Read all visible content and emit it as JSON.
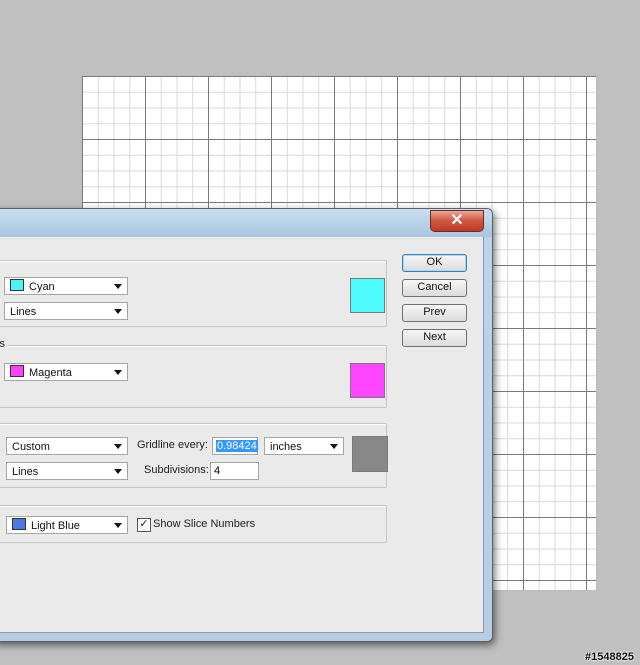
{
  "dialog": {
    "close_glyph": "✕"
  },
  "buttons": {
    "ok": "OK",
    "cancel": "Cancel",
    "prev": "Prev",
    "next": "Next"
  },
  "guides": {
    "color": {
      "value": "Cyan",
      "swatch": "#4df2f5"
    },
    "style": {
      "value": "Lines"
    },
    "preview_color": "#4dfbfd"
  },
  "smart_guides": {
    "label": "les",
    "color": {
      "value": "Magenta",
      "swatch": "#ff40ff"
    },
    "preview_color": "#ff44ff"
  },
  "grid": {
    "color": {
      "value": "Custom"
    },
    "style": {
      "value": "Lines"
    },
    "gridline_label": "Gridline every:",
    "gridline_value": "0.98424",
    "units": {
      "value": "inches"
    },
    "subdivisions_label": "Subdivisions:",
    "subdivisions_value": "4",
    "preview_color": "#888888"
  },
  "slices": {
    "color": {
      "value": "Light Blue",
      "swatch": "#4a78e6"
    },
    "show_numbers_label": "Show Slice Numbers",
    "show_numbers_checked": "✓"
  },
  "watermark": "#1548825"
}
